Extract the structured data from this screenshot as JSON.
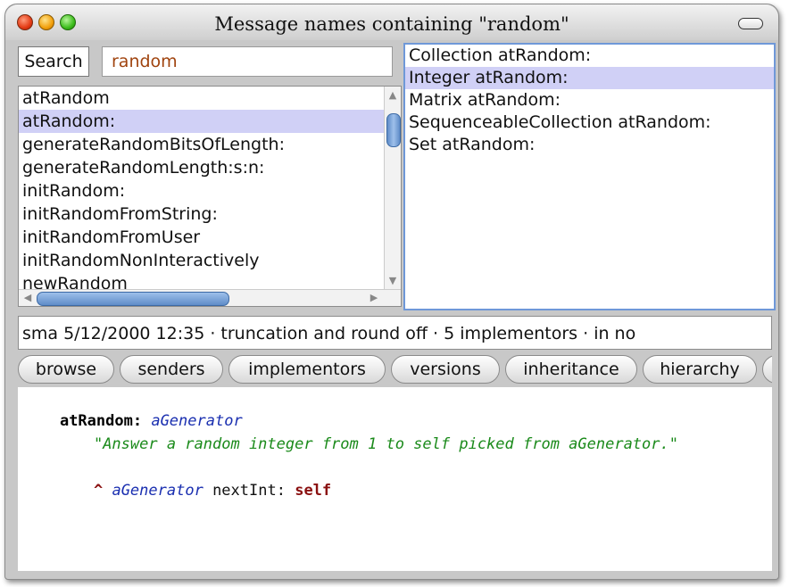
{
  "window": {
    "title": "Message names containing \"random\""
  },
  "search": {
    "button_label": "Search",
    "query": "random"
  },
  "selectors": {
    "items": [
      {
        "label": "atRandom",
        "selected": false
      },
      {
        "label": "atRandom:",
        "selected": true
      },
      {
        "label": "generateRandomBitsOfLength:",
        "selected": false
      },
      {
        "label": "generateRandomLength:s:n:",
        "selected": false
      },
      {
        "label": "initRandom:",
        "selected": false
      },
      {
        "label": "initRandomFromString:",
        "selected": false
      },
      {
        "label": "initRandomFromUser",
        "selected": false
      },
      {
        "label": "initRandomNonInteractively",
        "selected": false
      },
      {
        "label": "newRandom",
        "selected": false
      }
    ]
  },
  "implementors": {
    "items": [
      {
        "label": "Collection atRandom:",
        "selected": false
      },
      {
        "label": "Integer atRandom:",
        "selected": true
      },
      {
        "label": "Matrix atRandom:",
        "selected": false
      },
      {
        "label": "SequenceableCollection atRandom:",
        "selected": false
      },
      {
        "label": "Set atRandom:",
        "selected": false
      }
    ]
  },
  "status": {
    "text": "sma 5/12/2000 12:35 · truncation and round off · 5 implementors · in no"
  },
  "buttons": [
    "browse",
    "senders",
    "implementors",
    "versions",
    "inheritance",
    "hierarchy"
  ],
  "code": {
    "selector": "atRandom:",
    "argument": "aGenerator",
    "comment": "\"Answer a random integer from 1 to self picked from aGenerator.\"",
    "caret": "^",
    "return_receiver": "aGenerator",
    "return_message": "nextInt:",
    "return_arg": "self"
  }
}
